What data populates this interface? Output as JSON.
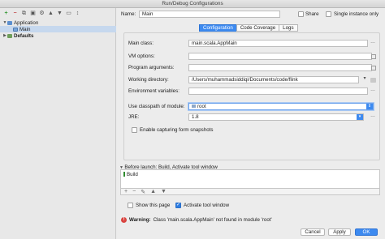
{
  "window": {
    "title": "Run/Debug Configurations"
  },
  "toolbar": {
    "icons": [
      "add-icon",
      "remove-icon",
      "copy-icon",
      "save-icon",
      "wrench-icon",
      "up-icon",
      "down-icon",
      "folder-icon",
      "sort-icon"
    ]
  },
  "tree": {
    "application": "Application",
    "main": "Main",
    "defaults": "Defaults"
  },
  "header": {
    "name_label": "Name:",
    "name_value": "Main",
    "share_label": "Share",
    "single_instance_label": "Single instance only"
  },
  "tabs": [
    "Configuration",
    "Code Coverage",
    "Logs"
  ],
  "form": {
    "main_class_label": "Main class:",
    "main_class_value": "main.scala.AppMain",
    "vm_options_label": "VM options:",
    "vm_options_value": "",
    "program_args_label": "Program arguments:",
    "program_args_value": "",
    "working_dir_label": "Working directory:",
    "working_dir_value": "/Users/muhammadsiddiqi/Documents/code/flink",
    "env_vars_label": "Environment variables:",
    "env_vars_value": "",
    "classpath_label": "Use classpath of module:",
    "classpath_value": "root",
    "jre_label": "JRE:",
    "jre_value": "1.8",
    "capture_label": "Enable capturing form snapshots"
  },
  "before_launch": {
    "title": "Before launch: Build, Activate tool window",
    "task": "Build",
    "show_page_label": "Show this page",
    "activate_label": "Activate tool window"
  },
  "warning": {
    "bold": "Warning:",
    "text": "Class 'main.scala.AppMain' not found in module 'root'"
  },
  "buttons": {
    "cancel": "Cancel",
    "apply": "Apply",
    "ok": "OK"
  }
}
